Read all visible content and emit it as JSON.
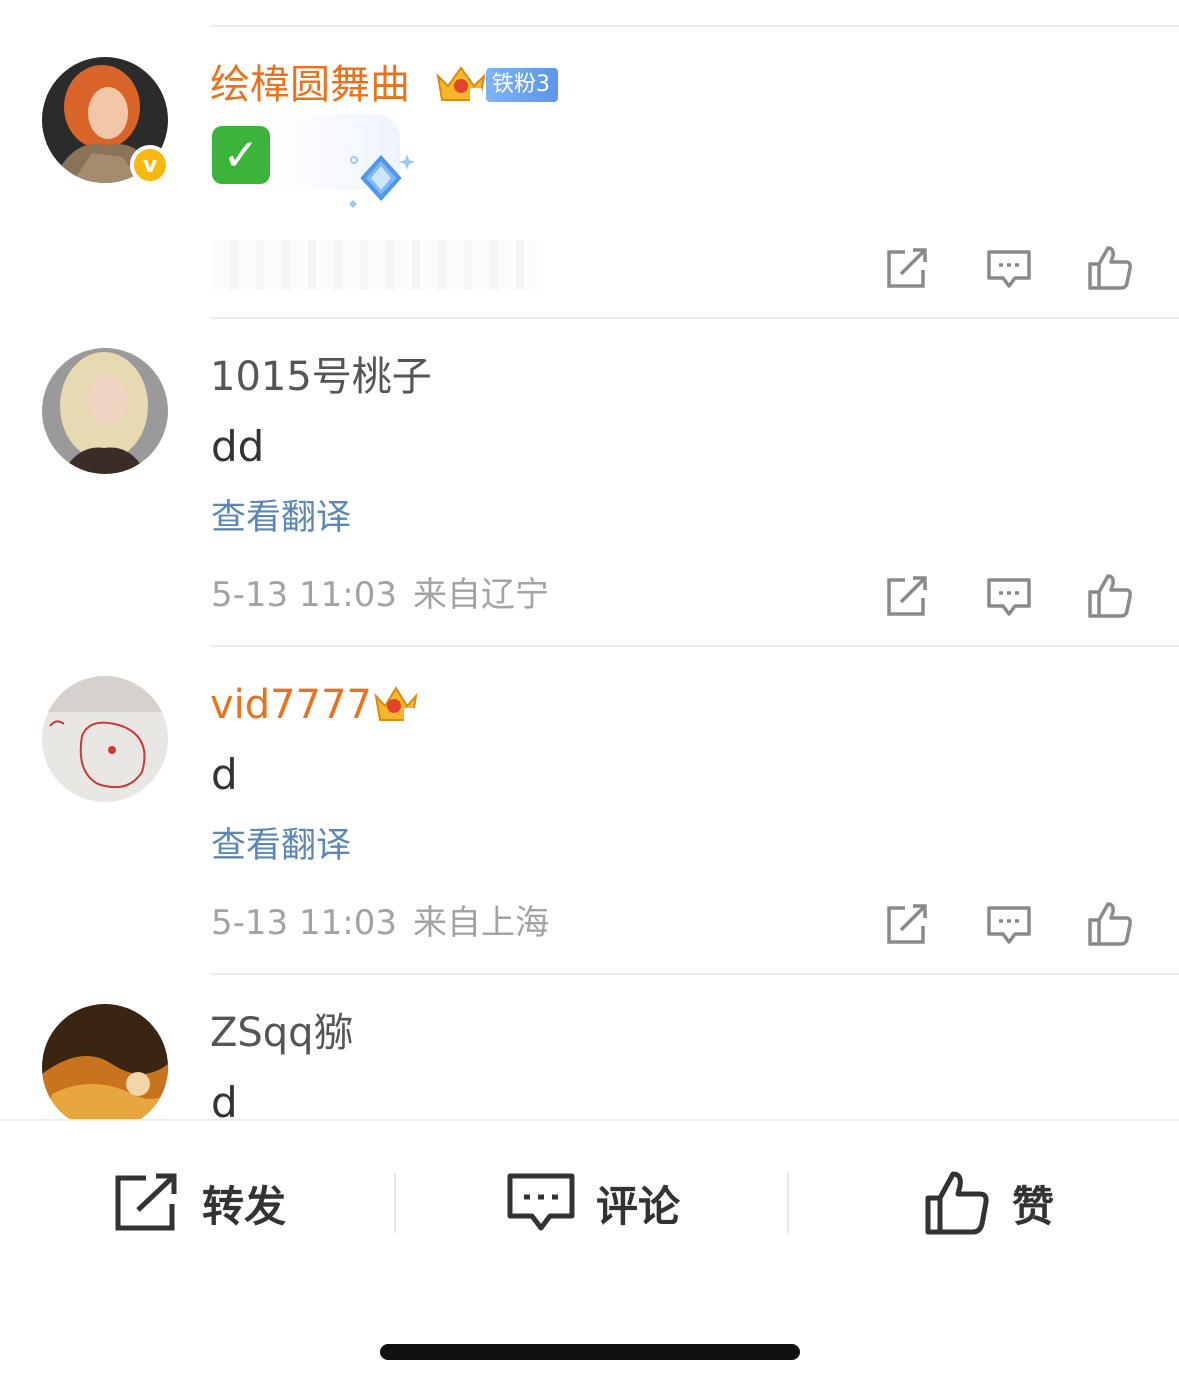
{
  "comments": [
    {
      "username": "绘椲圆舞曲",
      "fan_badge": "铁粉3",
      "crown_level": "8",
      "content_icon": "check-mark-emoji",
      "meta": null
    },
    {
      "username": "1015号桃子",
      "content": "dd",
      "translate": "查看翻译",
      "time": "5-13 11:03",
      "location": "来自辽宁"
    },
    {
      "username": "vid7777",
      "crown_level": "4",
      "content": "d",
      "translate": "查看翻译",
      "time": "5-13 11:03",
      "location": "来自上海"
    },
    {
      "username": "ZSqq猕",
      "content": "d"
    }
  ],
  "bottom_bar": {
    "repost": "转发",
    "comment": "评论",
    "like": "赞"
  },
  "colors": {
    "vip_name": "#e8731f",
    "link": "#5b86b8",
    "meta": "#a3a3a3",
    "verified": "#f6b90d"
  }
}
